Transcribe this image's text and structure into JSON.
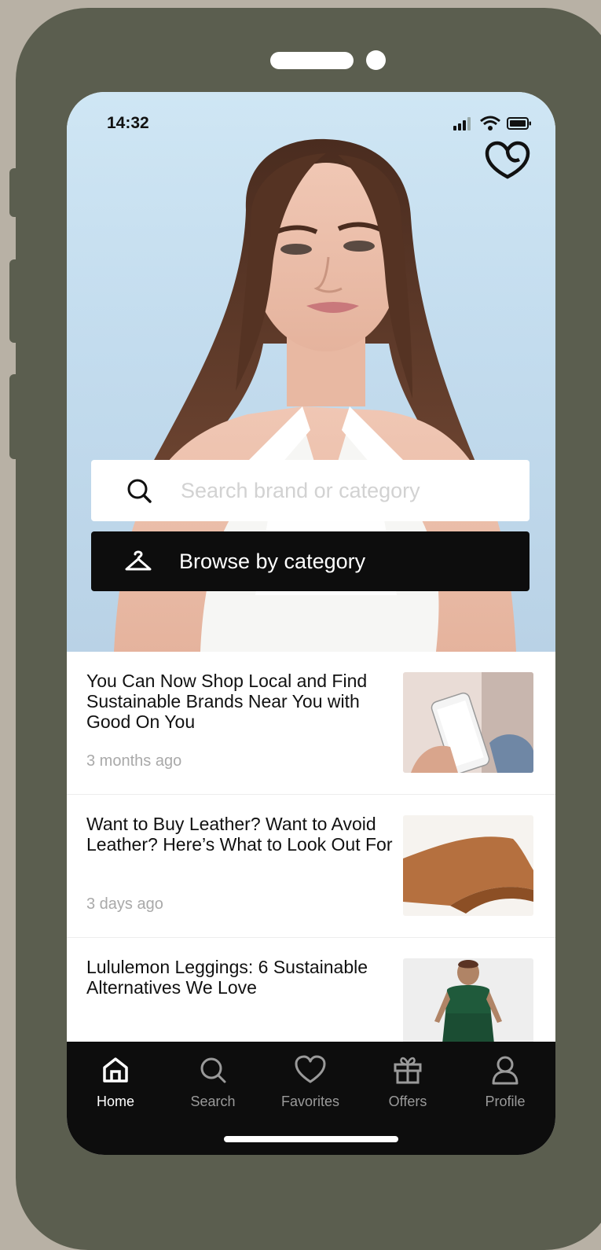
{
  "status": {
    "time": "14:32"
  },
  "search": {
    "placeholder": "Search brand or category"
  },
  "browse": {
    "label": "Browse by category"
  },
  "articles": [
    {
      "title": "You Can Now Shop Local and Find Sustainable Brands Near You with Good On You",
      "time": "3 months ago"
    },
    {
      "title": "Want to Buy Leather? Want to Avoid Leather? Here’s What to Look Out For",
      "time": "3 days ago"
    },
    {
      "title": "Lululemon Leggings: 6 Sustainable Alternatives We Love",
      "time": ""
    }
  ],
  "tabs": [
    {
      "label": "Home",
      "icon": "home-icon",
      "active": true
    },
    {
      "label": "Search",
      "icon": "search-icon",
      "active": false
    },
    {
      "label": "Favorites",
      "icon": "heart-icon",
      "active": false
    },
    {
      "label": "Offers",
      "icon": "gift-icon",
      "active": false
    },
    {
      "label": "Profile",
      "icon": "user-icon",
      "active": false
    }
  ],
  "colors": {
    "device": "#5b5e4f",
    "background": "#b8b1a5",
    "dark": "#0d0d0d",
    "placeholder": "#d2d2d2",
    "meta": "#a9a9a9"
  }
}
